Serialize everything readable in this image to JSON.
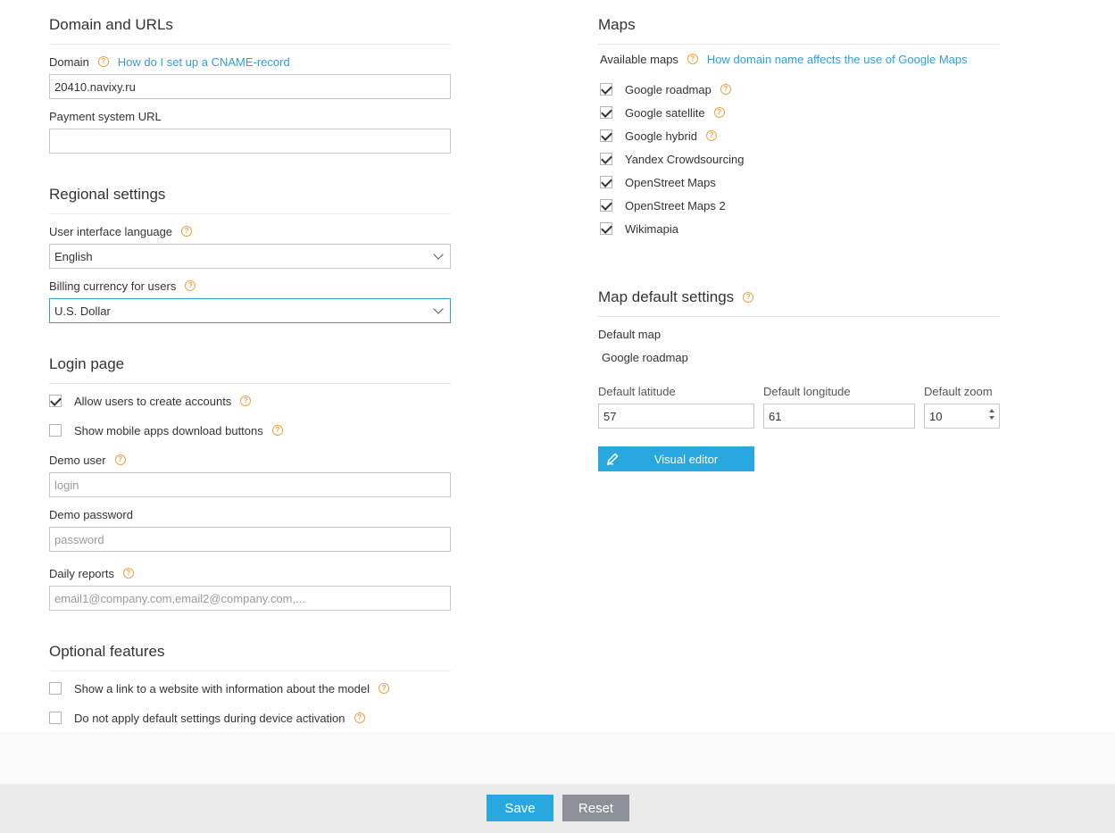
{
  "domain_section": {
    "title": "Domain and URLs",
    "domain_label": "Domain",
    "domain_help_link": "How do I set up a CNAME-record",
    "domain_value": "20410.navixy.ru",
    "payment_label": "Payment system URL",
    "payment_value": ""
  },
  "regional": {
    "title": "Regional settings",
    "language_label": "User interface language",
    "language_value": "English",
    "currency_label": "Billing currency for users",
    "currency_value": "U.S. Dollar"
  },
  "login_page": {
    "title": "Login page",
    "allow_accounts_label": "Allow users to create accounts",
    "allow_accounts_checked": true,
    "mobile_buttons_label": "Show mobile apps download buttons",
    "mobile_buttons_checked": false,
    "demo_user_label": "Demo user",
    "demo_user_placeholder": "login",
    "demo_password_label": "Demo password",
    "demo_password_placeholder": "password",
    "daily_reports_label": "Daily reports",
    "daily_reports_placeholder": "email1@company.com,email2@company.com,..."
  },
  "optional": {
    "title": "Optional features",
    "model_link_label": "Show a link to a website with information about the model",
    "model_link_checked": false,
    "no_default_label": "Do not apply default settings during device activation",
    "no_default_checked": false
  },
  "maps": {
    "title": "Maps",
    "available_label": "Available maps",
    "available_help_link": "How domain name affects the use of Google Maps",
    "items": [
      {
        "label": "Google roadmap",
        "checked": true,
        "help": true
      },
      {
        "label": "Google satellite",
        "checked": true,
        "help": true
      },
      {
        "label": "Google hybrid",
        "checked": true,
        "help": true
      },
      {
        "label": "Yandex Crowdsourcing",
        "checked": true,
        "help": false
      },
      {
        "label": "OpenStreet Maps",
        "checked": true,
        "help": false
      },
      {
        "label": "OpenStreet Maps 2",
        "checked": true,
        "help": false
      },
      {
        "label": "Wikimapia",
        "checked": true,
        "help": false
      }
    ]
  },
  "map_defaults": {
    "title": "Map default settings",
    "default_map_label": "Default map",
    "default_map_value": "Google roadmap",
    "latitude_label": "Default latitude",
    "latitude_value": "57",
    "longitude_label": "Default longitude",
    "longitude_value": "61",
    "zoom_label": "Default zoom",
    "zoom_value": "10",
    "visual_editor_label": "Visual editor"
  },
  "footer": {
    "save_label": "Save",
    "reset_label": "Reset"
  },
  "colors": {
    "accent": "#29a8e0",
    "help_icon": "#f0a140",
    "reset_button": "#8e9097",
    "link": "#2d9fd9"
  },
  "help_glyph": "?"
}
